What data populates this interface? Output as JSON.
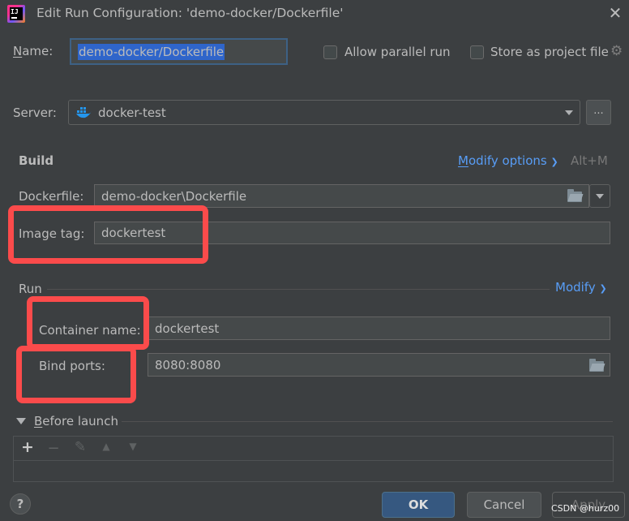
{
  "window": {
    "title": "Edit Run Configuration: 'demo-docker/Dockerfile'",
    "close_icon": "close-icon"
  },
  "header": {
    "name_label": "Name:",
    "name_value": "demo-docker/Dockerfile",
    "allow_parallel_label": "Allow parallel run",
    "allow_parallel_checked": false,
    "store_project_label": "Store as project file",
    "store_project_checked": false
  },
  "server": {
    "label": "Server:",
    "value": "docker-test",
    "browse_label": "..."
  },
  "build": {
    "section_title": "Build",
    "modify_options_label": "Modify options",
    "modify_options_shortcut": "Alt+M",
    "dockerfile_label": "Dockerfile:",
    "dockerfile_value": "demo-docker\\Dockerfile",
    "image_tag_label": "Image tag:",
    "image_tag_value": "dockertest"
  },
  "run": {
    "section_title": "Run",
    "modify_label": "Modify",
    "container_name_label": "Container name:",
    "container_name_value": "dockertest",
    "bind_ports_label": "Bind ports:",
    "bind_ports_value": "8080:8080"
  },
  "before_launch": {
    "title": "Before launch",
    "tools": [
      "add-icon",
      "remove-icon",
      "edit-icon",
      "move-up-icon",
      "move-down-icon"
    ]
  },
  "footer": {
    "help_label": "?",
    "ok_label": "OK",
    "cancel_label": "Cancel",
    "apply_label": "Apply"
  },
  "watermark": "CSDN @hurz00",
  "colors": {
    "background": "#3c3f41",
    "accent_link": "#589df6",
    "annotation_red": "#fb4b4b",
    "primary_button": "#365880"
  }
}
